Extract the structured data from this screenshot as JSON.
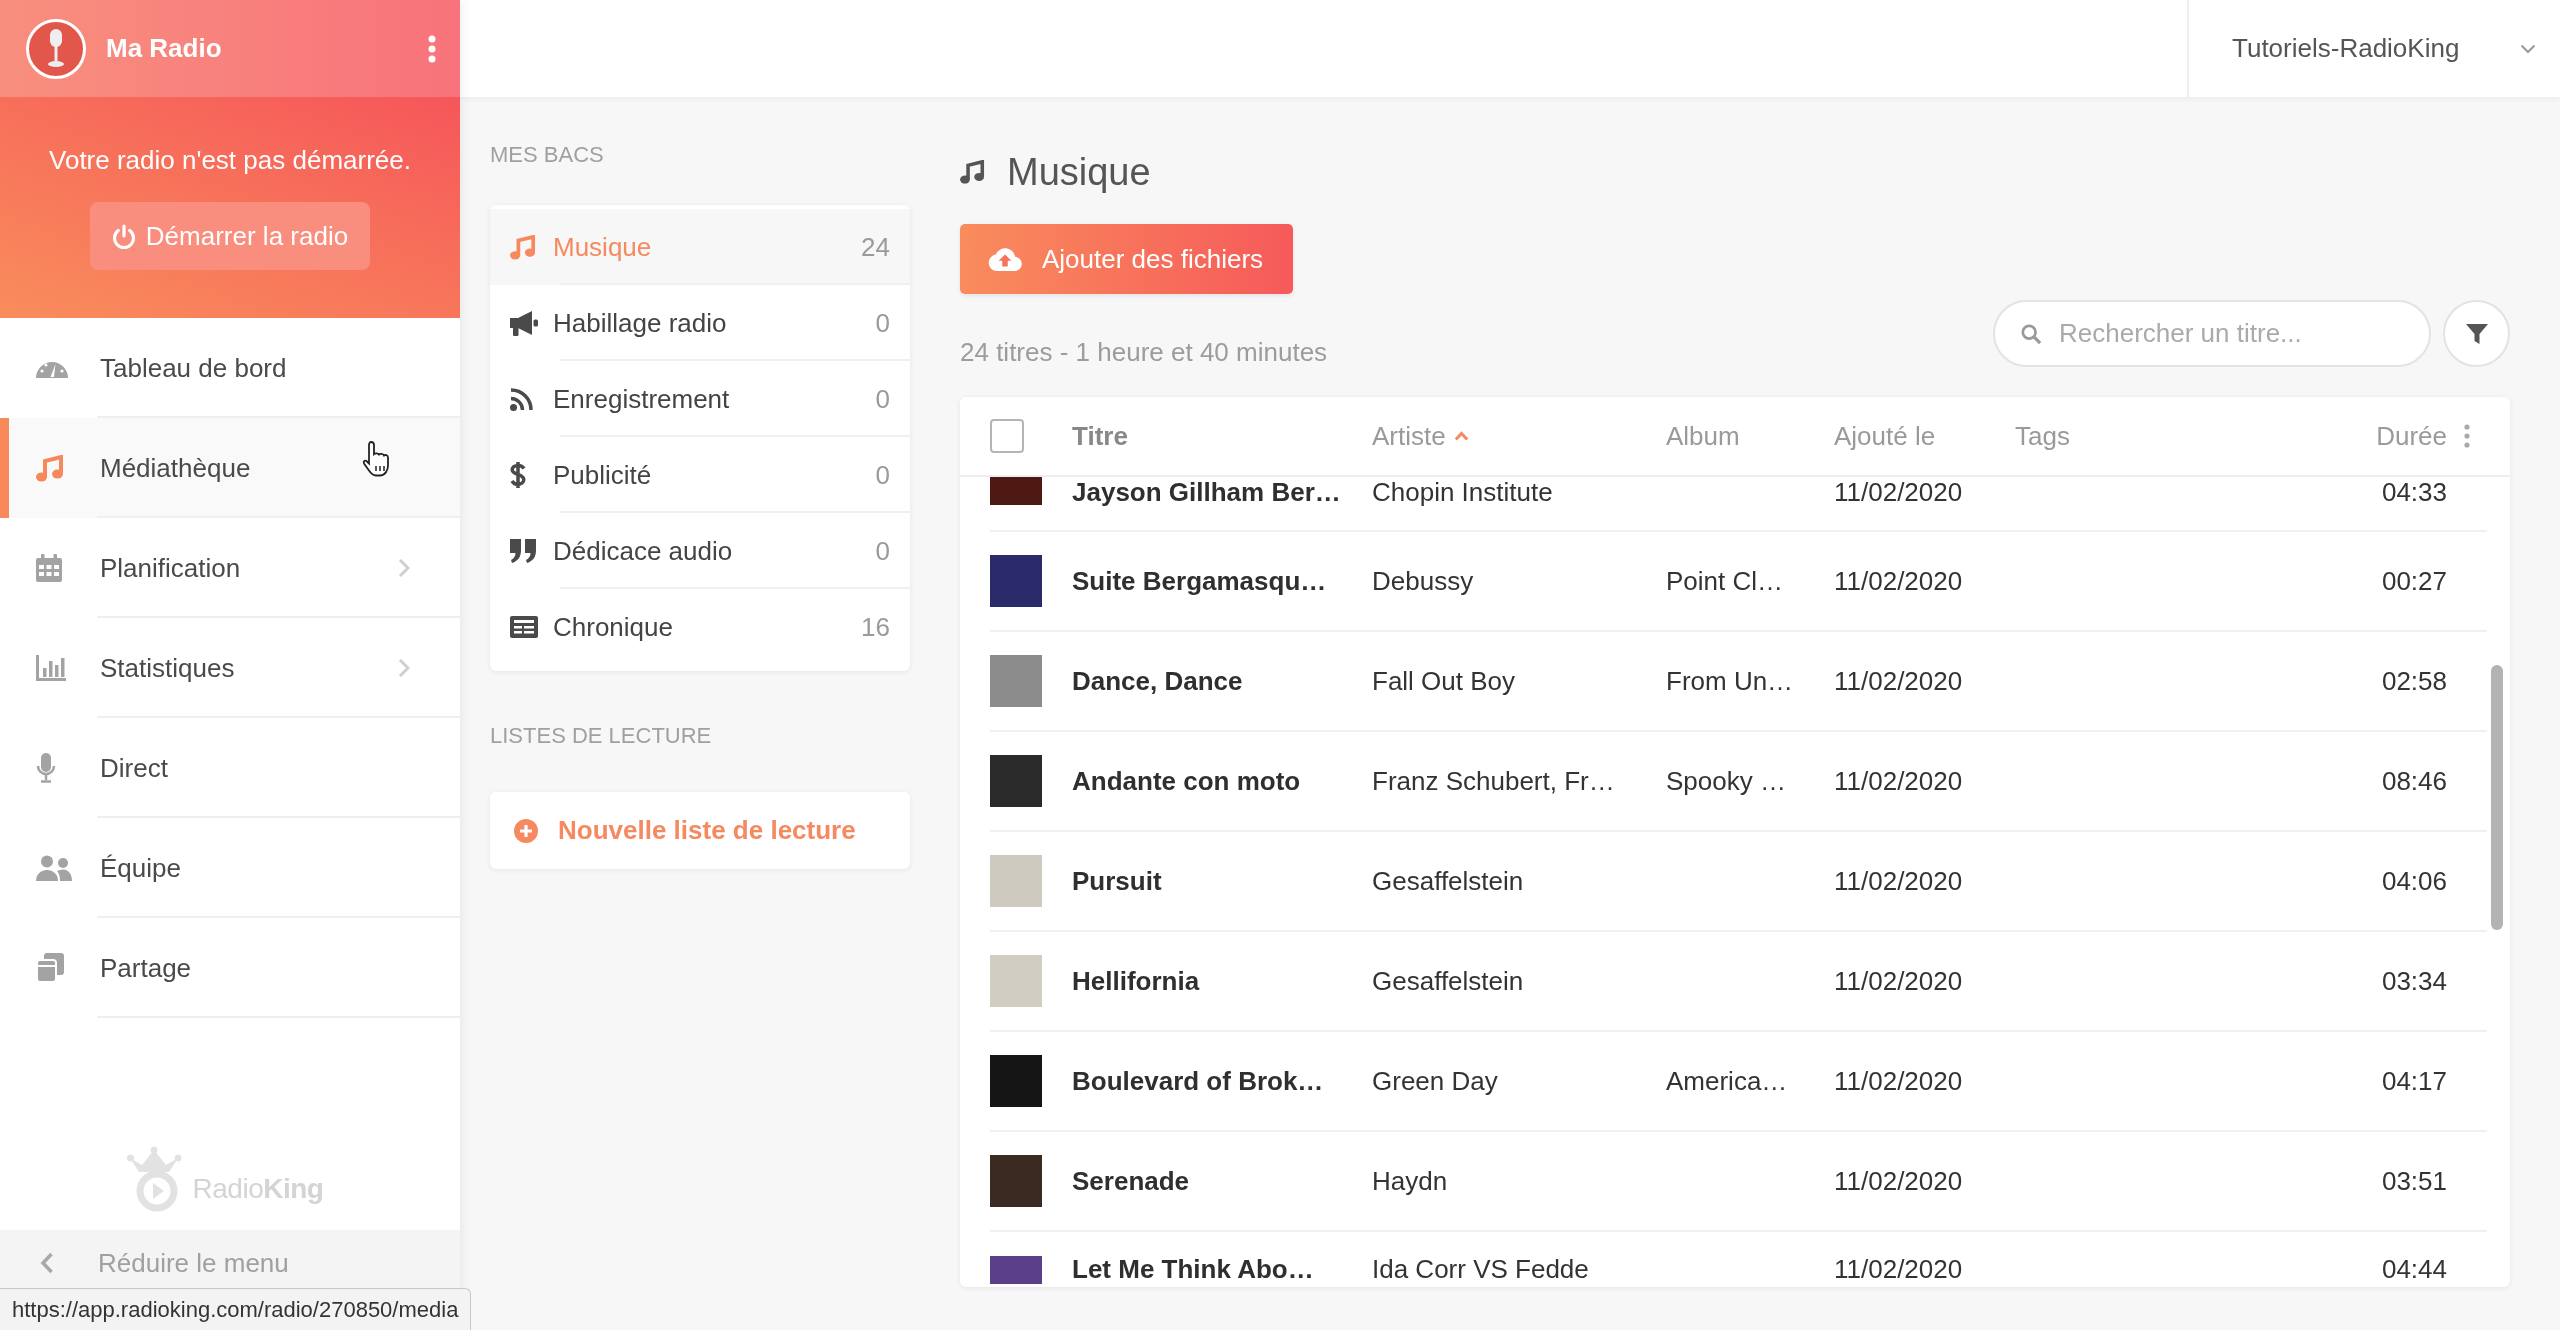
{
  "sidebar": {
    "station": "Ma Radio",
    "notice": {
      "message": "Votre radio n'est pas démarrée.",
      "start_button": {
        "label": "Démarrer la radio",
        "on": false
      }
    },
    "items": [
      {
        "label": "Tableau de bord",
        "selected": false,
        "submenu": false
      },
      {
        "label": "Médiathèque",
        "selected": true,
        "submenu": false
      },
      {
        "label": "Planification",
        "selected": false,
        "submenu": true
      },
      {
        "label": "Statistiques",
        "selected": false,
        "submenu": true
      },
      {
        "label": "Direct",
        "selected": false,
        "submenu": false
      },
      {
        "label": "Équipe",
        "selected": false,
        "submenu": false
      },
      {
        "label": "Partage",
        "selected": false,
        "submenu": false
      }
    ],
    "brand": "Radio**King**",
    "collapse_button": "Réduire le menu"
  },
  "top_bar": {
    "account": "Tutoriels-RadioKing"
  },
  "bins": {
    "heading": "MES BACS",
    "items": [
      {
        "label": "Musique",
        "count": "24",
        "selected": true
      },
      {
        "label": "Habillage radio",
        "count": "0",
        "selected": false
      },
      {
        "label": "Enregistrement",
        "count": "0",
        "selected": false
      },
      {
        "label": "Publicité",
        "count": "0",
        "selected": false
      },
      {
        "label": "Dédicace audio",
        "count": "0",
        "selected": false
      },
      {
        "label": "Chronique",
        "count": "16",
        "selected": false
      }
    ]
  },
  "playlists": {
    "heading": "LISTES DE LECTURE",
    "new_button": "Nouvelle liste de lecture"
  },
  "library": {
    "title": "Musique",
    "upload_button": "Ajouter des fichiers",
    "summary": "24 titres - 1 heure et 40 minutes",
    "search": {
      "placeholder": "Rechercher un titre..."
    },
    "table": {
      "select_all": {
        "checked": false
      },
      "columns": [
        {
          "label": "Titre",
          "sorted": false
        },
        {
          "label": "Artiste",
          "sorted": true
        },
        {
          "label": "Album",
          "sorted": false
        },
        {
          "label": "Ajouté le",
          "sorted": false
        },
        {
          "label": "Tags",
          "sorted": false
        },
        {
          "label": "Durée",
          "sorted": false
        }
      ],
      "rows": [
        {
          "title": "Jayson Gillham Ber…",
          "artist": "Chopin Institute",
          "added": "11/02/2020",
          "duration": "04:33"
        },
        {
          "title": "Suite Bergamasqu…",
          "artist": "Debussy",
          "album": "Point Cl…",
          "added": "11/02/2020",
          "duration": "00:27"
        },
        {
          "title": "Dance, Dance",
          "artist": "Fall Out Boy",
          "album": "From Un…",
          "added": "11/02/2020",
          "duration": "02:58"
        },
        {
          "title": "Andante con moto",
          "artist": "Franz Schubert, Fr…",
          "album": "Spooky …",
          "added": "11/02/2020",
          "duration": "08:46"
        },
        {
          "title": "Pursuit",
          "artist": "Gesaffelstein",
          "added": "11/02/2020",
          "duration": "04:06"
        },
        {
          "title": "Hellifornia",
          "artist": "Gesaffelstein",
          "added": "11/02/2020",
          "duration": "03:34"
        },
        {
          "title": "Boulevard of Brok…",
          "artist": "Green Day",
          "album": "America…",
          "added": "11/02/2020",
          "duration": "04:17"
        },
        {
          "title": "Serenade",
          "artist": "Haydn",
          "added": "11/02/2020",
          "duration": "03:51"
        },
        {
          "title": "Let Me Think Abo…",
          "artist": "Ida Corr VS Fedde",
          "added": "11/02/2020",
          "duration": "04:44"
        }
      ]
    }
  },
  "status_bar": {
    "url": "https://app.radioking.com/radio/270850/media"
  }
}
